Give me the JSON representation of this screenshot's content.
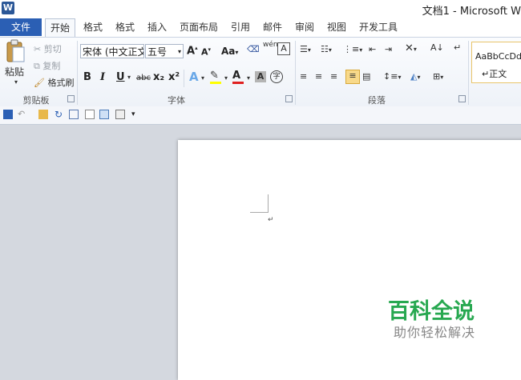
{
  "window": {
    "title": "文档1 - Microsoft W",
    "logo_letter": "W"
  },
  "tabs": {
    "file": "文件",
    "items": [
      "开始",
      "格式",
      "格式",
      "插入",
      "页面布局",
      "引用",
      "邮件",
      "审阅",
      "视图",
      "开发工具"
    ]
  },
  "clipboard": {
    "paste": "粘贴",
    "cut": "剪切",
    "copy": "复制",
    "format_painter": "格式刷",
    "group_label": "剪贴板"
  },
  "font": {
    "font_name": "宋体 (中文正文)",
    "font_size": "五号",
    "grow": "A",
    "shrink": "A",
    "case": "Aa",
    "phonetic": "wén",
    "bold": "B",
    "italic": "I",
    "underline": "U",
    "strike": "abc",
    "subscript": "x₂",
    "superscript": "x²",
    "text_effect": "A",
    "font_color": "A",
    "char_shading": "A",
    "enclose": "字",
    "group_label": "字体"
  },
  "paragraph": {
    "group_label": "段落"
  },
  "styles": {
    "preview": "AaBbCcDdI",
    "normal": "↵正文"
  },
  "document": {
    "paragraph_mark": "↵"
  },
  "watermark": {
    "title": "百科全说",
    "subtitle": "助你轻松解决"
  },
  "colors": {
    "file_tab": "#2b5fb4",
    "highlight": "#ffff00",
    "font_color": "#e02020",
    "watermark": "#27a850"
  }
}
